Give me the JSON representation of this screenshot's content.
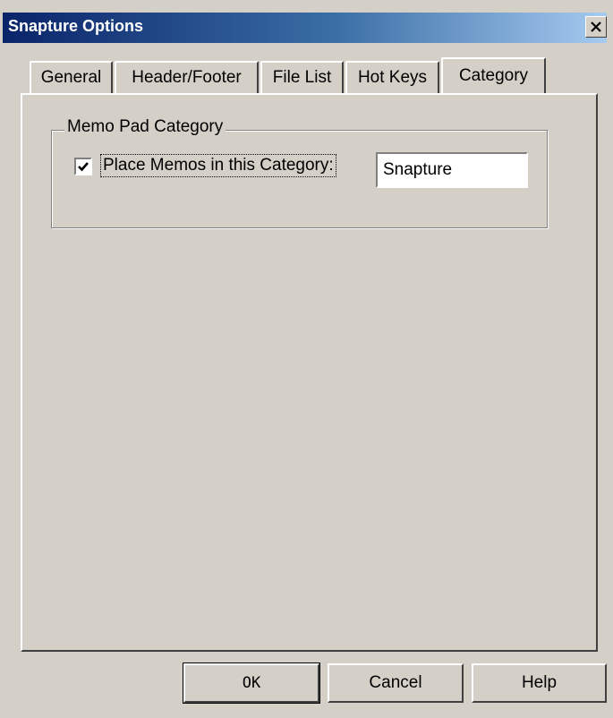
{
  "window": {
    "title": "Snapture Options"
  },
  "tabs": [
    {
      "label": "General",
      "active": false
    },
    {
      "label": "Header/Footer",
      "active": false
    },
    {
      "label": "File List",
      "active": false
    },
    {
      "label": "Hot Keys",
      "active": false
    },
    {
      "label": "Category",
      "active": true
    }
  ],
  "category_panel": {
    "group_title": "Memo Pad Category",
    "checkbox_label": "Place Memos in this Category:",
    "checkbox_checked": true,
    "category_value": "Snapture"
  },
  "buttons": {
    "ok": "OK",
    "cancel": "Cancel",
    "help": "Help"
  },
  "colors": {
    "face": "#d4d0c8",
    "title_start": "#0a246a",
    "title_end": "#a6caf0"
  }
}
